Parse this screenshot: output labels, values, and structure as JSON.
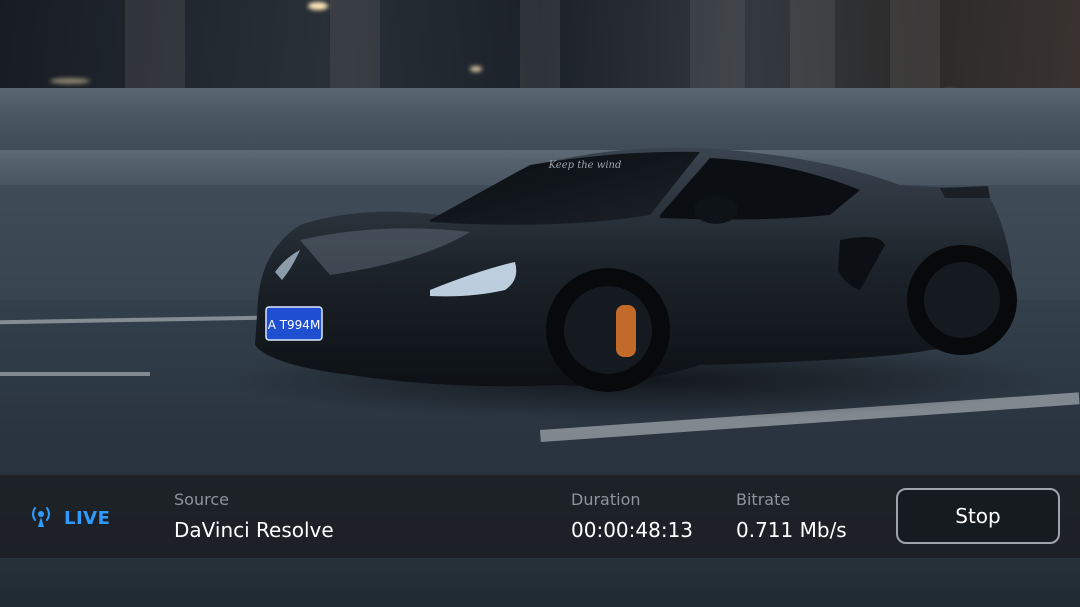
{
  "video": {
    "plate_text": "A T994M",
    "windshield_text": "Keep the wind"
  },
  "status_bar": {
    "live_label": "LIVE",
    "live_icon": "broadcast-icon",
    "source_caption": "Source",
    "source_value": "DaVinci Resolve",
    "duration_caption": "Duration",
    "duration_value": "00:00:48:13",
    "bitrate_caption": "Bitrate",
    "bitrate_value": "0.711 Mb/s",
    "stop_label": "Stop",
    "accent_color": "#2f9bff"
  }
}
